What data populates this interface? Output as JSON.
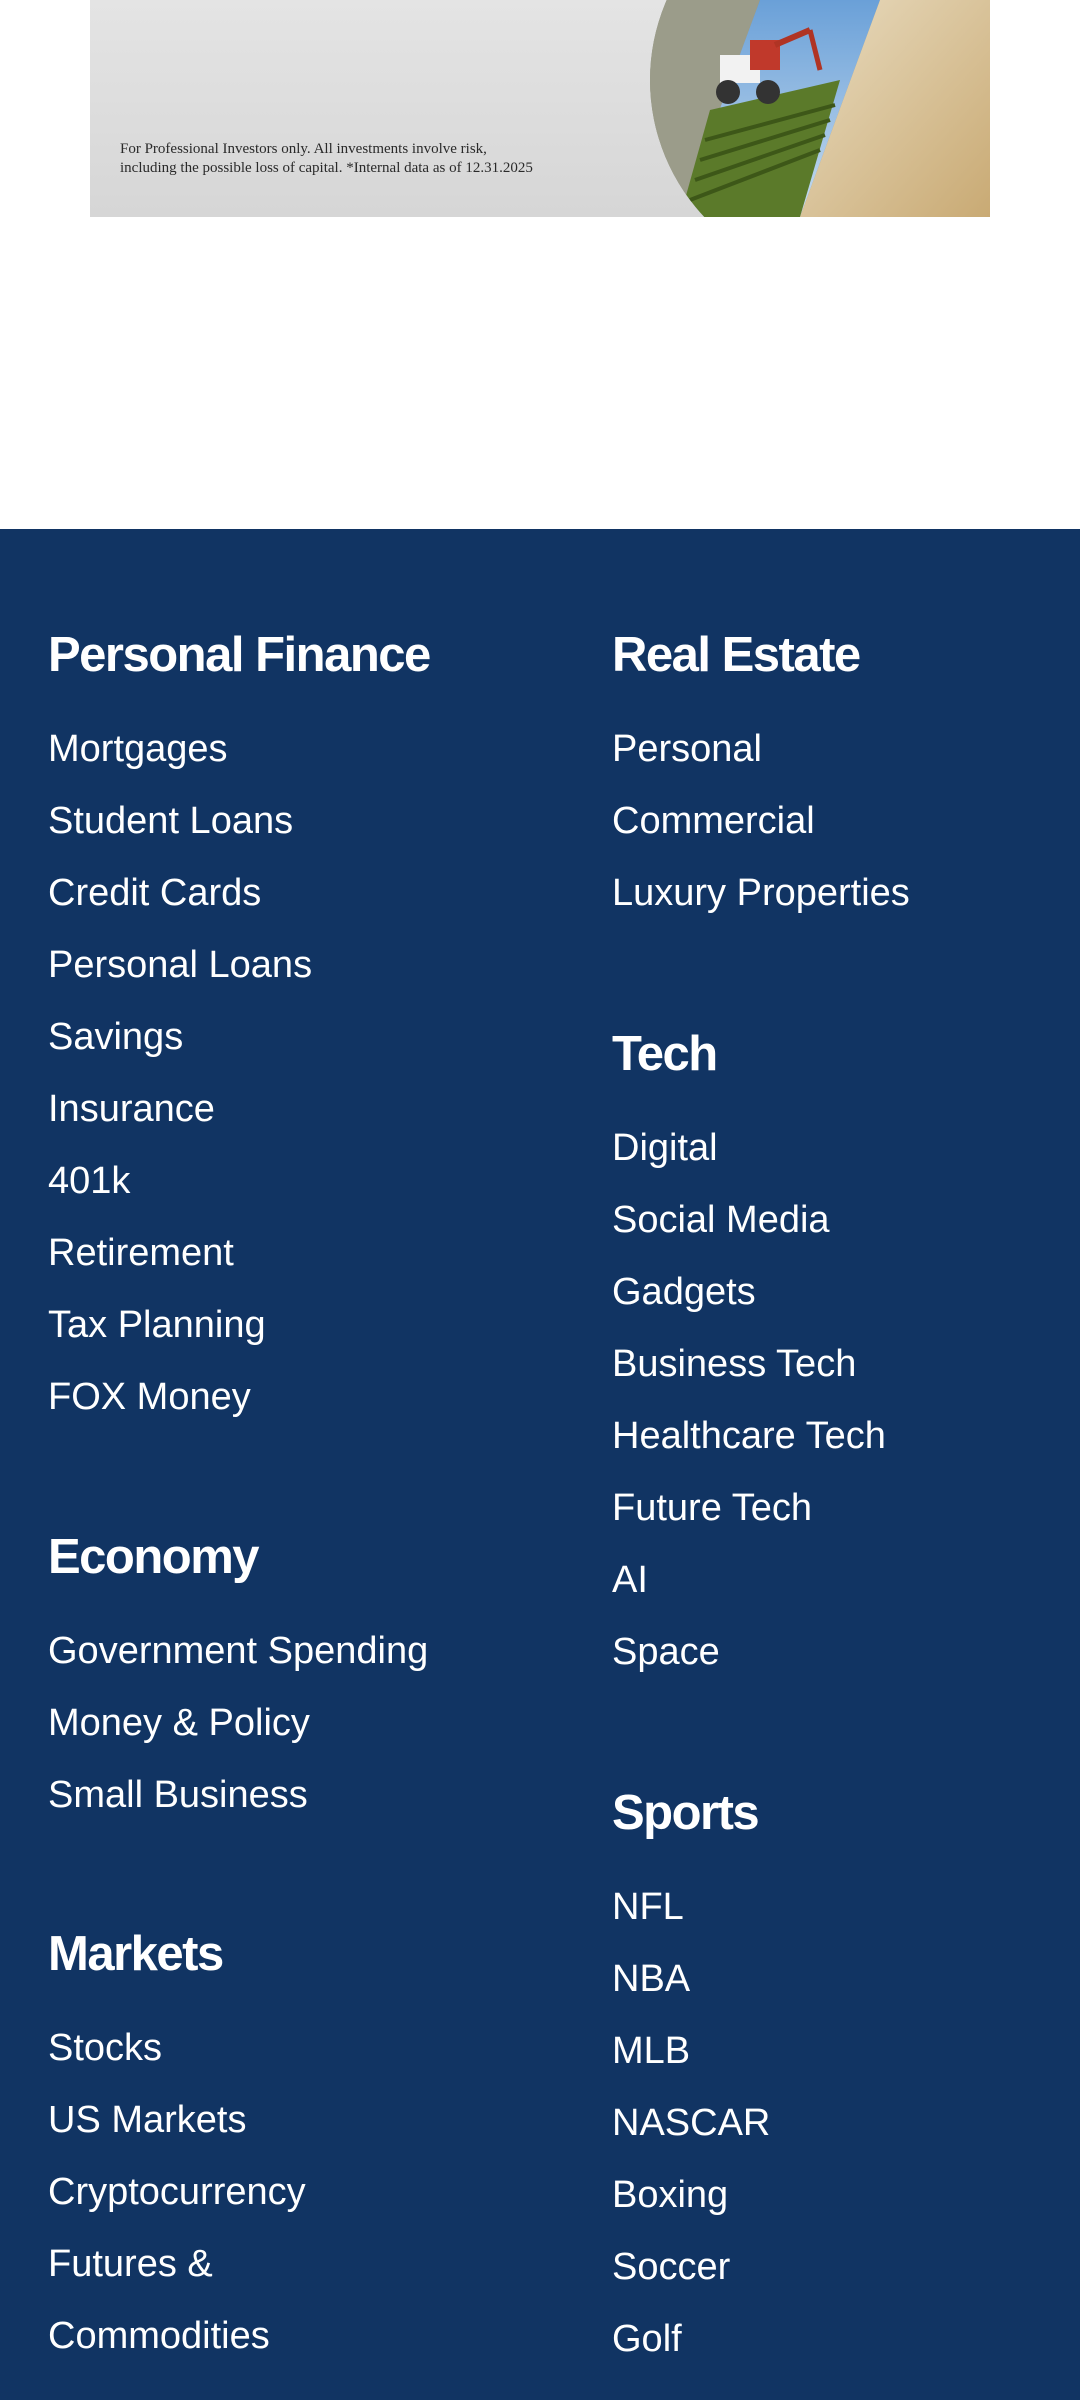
{
  "ad": {
    "disclaimer_line1": "For Professional Investors only. All investments involve risk,",
    "disclaimer_line2": "including the possible loss of capital. *Internal data as of 12.31.2025"
  },
  "footer": {
    "personal_finance": {
      "title": "Personal Finance",
      "links": [
        "Mortgages",
        "Student Loans",
        "Credit Cards",
        "Personal Loans",
        "Savings",
        "Insurance",
        "401k",
        "Retirement",
        "Tax Planning",
        "FOX Money"
      ]
    },
    "economy": {
      "title": "Economy",
      "links": [
        "Government Spending",
        "Money & Policy",
        "Small Business"
      ]
    },
    "markets": {
      "title": "Markets",
      "links": [
        "Stocks",
        "US Markets",
        "Cryptocurrency",
        "Futures & Commodities"
      ]
    },
    "real_estate": {
      "title": "Real Estate",
      "links": [
        "Personal",
        "Commercial",
        "Luxury Properties"
      ]
    },
    "tech": {
      "title": "Tech",
      "links": [
        "Digital",
        "Social Media",
        "Gadgets",
        "Business Tech",
        "Healthcare Tech",
        "Future Tech",
        "AI",
        "Space"
      ]
    },
    "sports": {
      "title": "Sports",
      "links": [
        "NFL",
        "NBA",
        "MLB",
        "NASCAR",
        "Boxing",
        "Soccer",
        "Golf"
      ]
    }
  },
  "colors": {
    "footer_bg": "#113463",
    "text": "#ffffff"
  }
}
